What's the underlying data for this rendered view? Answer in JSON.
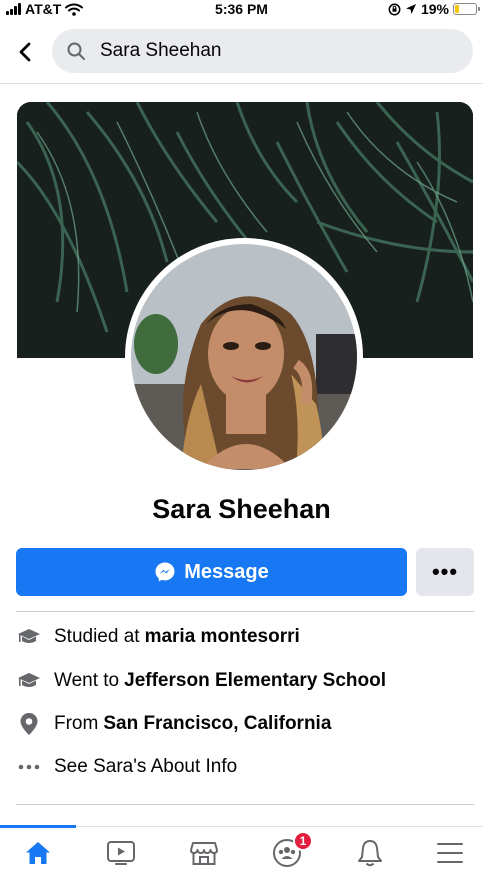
{
  "status_bar": {
    "carrier": "AT&T",
    "time": "5:36 PM",
    "battery": "19%",
    "battery_level": 0.19,
    "battery_color": "#f7c600"
  },
  "search": {
    "query": "Sara Sheehan"
  },
  "profile": {
    "name": "Sara Sheehan"
  },
  "actions": {
    "message_label": "Message",
    "more_label": "•••",
    "accent_color": "#1877f2"
  },
  "info": [
    {
      "icon": "graduation-cap-icon",
      "prefix": "Studied at",
      "value": "maria montesorri"
    },
    {
      "icon": "graduation-cap-icon",
      "prefix": "Went to",
      "value": "Jefferson Elementary School"
    },
    {
      "icon": "location-pin-icon",
      "prefix": "From",
      "value": "San Francisco, California"
    },
    {
      "icon": "more-dots-icon",
      "prefix": "See Sara's About Info",
      "value": ""
    }
  ],
  "tab_bar": {
    "tabs": [
      "home-icon",
      "watch-icon",
      "marketplace-icon",
      "groups-icon",
      "notifications-icon",
      "menu-icon"
    ],
    "active_tab": "home-icon",
    "groups_badge": "1"
  }
}
